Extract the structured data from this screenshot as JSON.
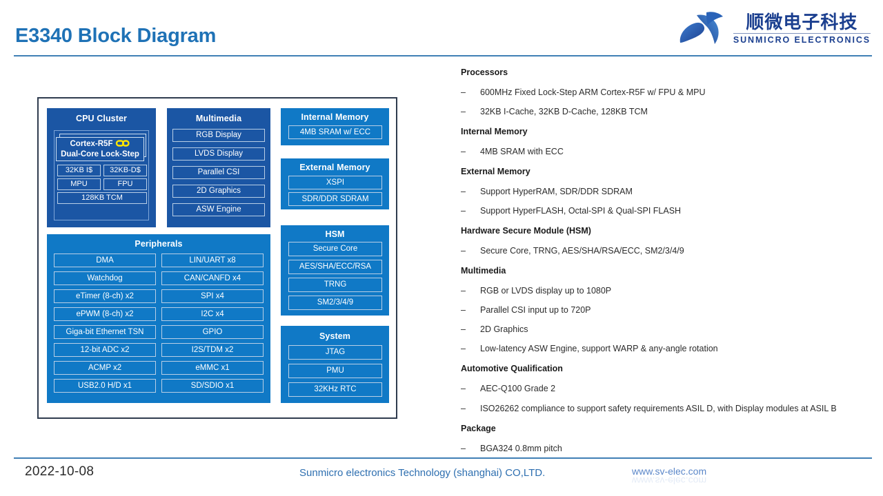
{
  "header": {
    "title": "E3340 Block Diagram",
    "logo": {
      "cn_name": "顺微电子科技",
      "en_name": "SUNMICRO ELECTRONICS",
      "mark": "n-logo-icon"
    }
  },
  "diagram": {
    "cpu_cluster": {
      "title": "CPU Cluster",
      "core_line1": "Cortex-R5F",
      "core_line2": "Dual-Core Lock-Step",
      "link_icon": "chain-link-icon",
      "row1": [
        "32KB I$",
        "32KB-D$"
      ],
      "row2": [
        "MPU",
        "FPU"
      ],
      "row3": [
        "128KB TCM"
      ]
    },
    "multimedia": {
      "title": "Multimedia",
      "items": [
        "RGB Display",
        "LVDS Display",
        "Parallel  CSI",
        "2D  Graphics",
        "ASW Engine"
      ]
    },
    "internal_memory": {
      "title": "Internal Memory",
      "items": [
        "4MB SRAM w/ ECC"
      ]
    },
    "external_memory": {
      "title": "External Memory",
      "items": [
        "XSPI",
        "SDR/DDR SDRAM"
      ]
    },
    "hsm": {
      "title": "HSM",
      "items": [
        "Secure Core",
        "AES/SHA/ECC/RSA",
        "TRNG",
        "SM2/3/4/9"
      ]
    },
    "system": {
      "title": "System",
      "items": [
        "JTAG",
        "PMU",
        "32KHz RTC"
      ]
    },
    "peripherals": {
      "title": "Peripherals",
      "items": [
        "DMA",
        "LIN/UART x8",
        "Watchdog",
        "CAN/CANFD x4",
        "eTimer (8-ch) x2",
        "SPI x4",
        "ePWM (8-ch) x2",
        "I2C x4",
        "Giga-bit Ethernet TSN",
        "GPIO",
        "12-bit ADC x2",
        "I2S/TDM x2",
        "ACMP x2",
        "eMMC x1",
        "USB2.0 H/D x1",
        "SD/SDIO x1"
      ]
    }
  },
  "specs": {
    "dash": "–",
    "sections": [
      {
        "heading": "Processors",
        "items": [
          "600MHz Fixed Lock-Step ARM Cortex-R5F w/ FPU & MPU",
          "32KB I-Cache,  32KB D-Cache,  128KB TCM"
        ]
      },
      {
        "heading": "Internal Memory",
        "items": [
          "4MB SRAM with ECC"
        ]
      },
      {
        "heading": "External Memory",
        "items": [
          "Support HyperRAM, SDR/DDR  SDRAM",
          "Support HyperFLASH, Octal-SPI & Qual-SPI FLASH"
        ]
      },
      {
        "heading": "Hardware Secure Module (HSM)",
        "items": [
          "Secure  Core, TRNG, AES/SHA/RSA/ECC, SM2/3/4/9"
        ]
      },
      {
        "heading": "Multimedia",
        "items": [
          "RGB or LVDS display up to 1080P",
          "Parallel CSI input up to 720P",
          "2D Graphics",
          "Low-latency ASW Engine, support WARP & any-angle rotation"
        ]
      },
      {
        "heading": "Automotive  Qualification",
        "items": [
          "AEC-Q100 Grade 2",
          "ISO26262 compliance to support safety requirements ASIL D, with Display modules at ASIL B"
        ]
      },
      {
        "heading": "Package",
        "items": [
          "BGA324 0.8mm pitch"
        ]
      }
    ]
  },
  "footer": {
    "date": "2022-10-08",
    "company": "Sunmicro electronics Technology (shanghai) CO,LTD.",
    "url": "www.sv-elec.com"
  },
  "colors": {
    "title_blue": "#1f72b6",
    "rule_blue": "#3f7fb5",
    "block_navy": "#1b56a4",
    "block_bright": "#1079c6",
    "diagram_border": "#2f3b4e",
    "link_yellow": "#ffe600"
  }
}
